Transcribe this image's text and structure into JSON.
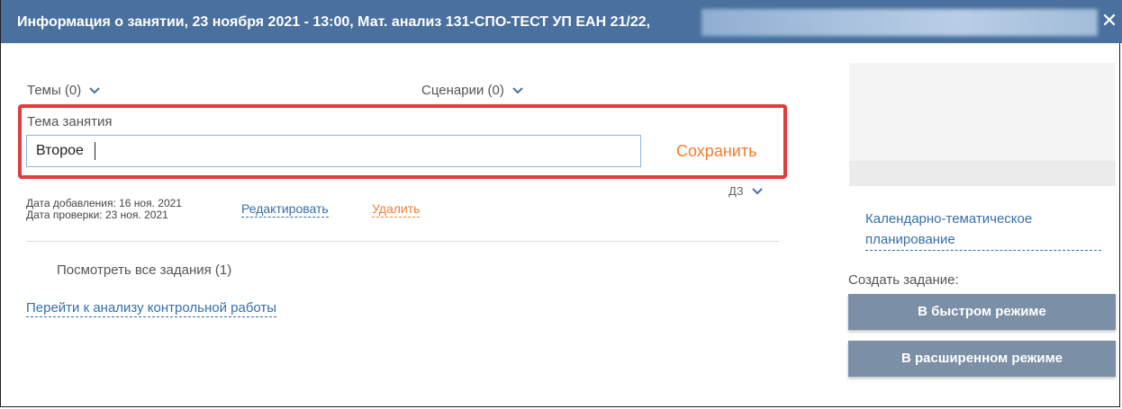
{
  "dialog": {
    "title": "Информация о занятии, 23 ноября 2021 - 13:00, Мат. анализ 131-СПО-ТЕСТ УП ЕАН 21/22,",
    "close_icon": "close-icon",
    "header_color": "#49709e"
  },
  "dropdowns": {
    "topics_label": "Темы (0)",
    "scenarios_label": "Сценарии (0)",
    "homework_label": "ДЗ"
  },
  "topic": {
    "label": "Тема занятия",
    "value": "Второе",
    "save_label": "Сохранить"
  },
  "meta": {
    "added_date": "Дата добавления: 16 ноя. 2021",
    "checked_date": "Дата проверки: 23 ноя. 2021",
    "edit_label": "Редактировать",
    "delete_label": "Удалить"
  },
  "links": {
    "view_all_tasks": "Посмотреть все задания (1)",
    "test_analysis": "Перейти к анализу контрольной работы"
  },
  "sidebar": {
    "plan_link_line1": "Календарно-тематическое",
    "plan_link_line2": "планирование",
    "create_task_label": "Создать задание:",
    "quick_mode_button": "В быстром режиме",
    "extended_mode_button": "В расширенном режиме"
  },
  "colors": {
    "accent_orange": "#f47c2c",
    "link_blue": "#356fa8",
    "highlight_red": "#e23c3c",
    "button_gray_blue": "#7b8fa6"
  }
}
